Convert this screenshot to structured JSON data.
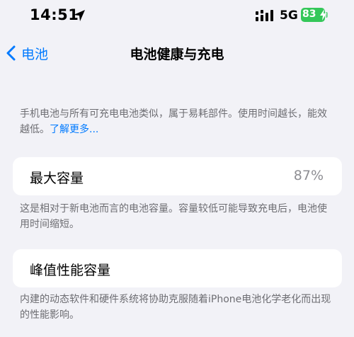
{
  "status_bar": {
    "time": "14:51",
    "network": "5G",
    "battery_percent": "83",
    "battery_color": "#34c759"
  },
  "nav": {
    "back_label": "电池",
    "title": "电池健康与充电"
  },
  "intro": {
    "text": "手机电池与所有可充电电池类似，属于易耗部件。使用时间越长，能效越低。",
    "link": "了解更多..."
  },
  "max_capacity": {
    "label": "最大容量",
    "value": "87%",
    "description": "这是相对于新电池而言的电池容量。容量较低可能导致充电后，电池使用时间缩短。"
  },
  "peak_performance": {
    "label": "峰值性能容量",
    "description": "内建的动态软件和硬件系统将协助克服随着iPhone电池化学老化而出现的性能影响。"
  },
  "colors": {
    "accent": "#007aff",
    "background": "#f2f2f7",
    "secondary_text": "#6d6d72"
  }
}
